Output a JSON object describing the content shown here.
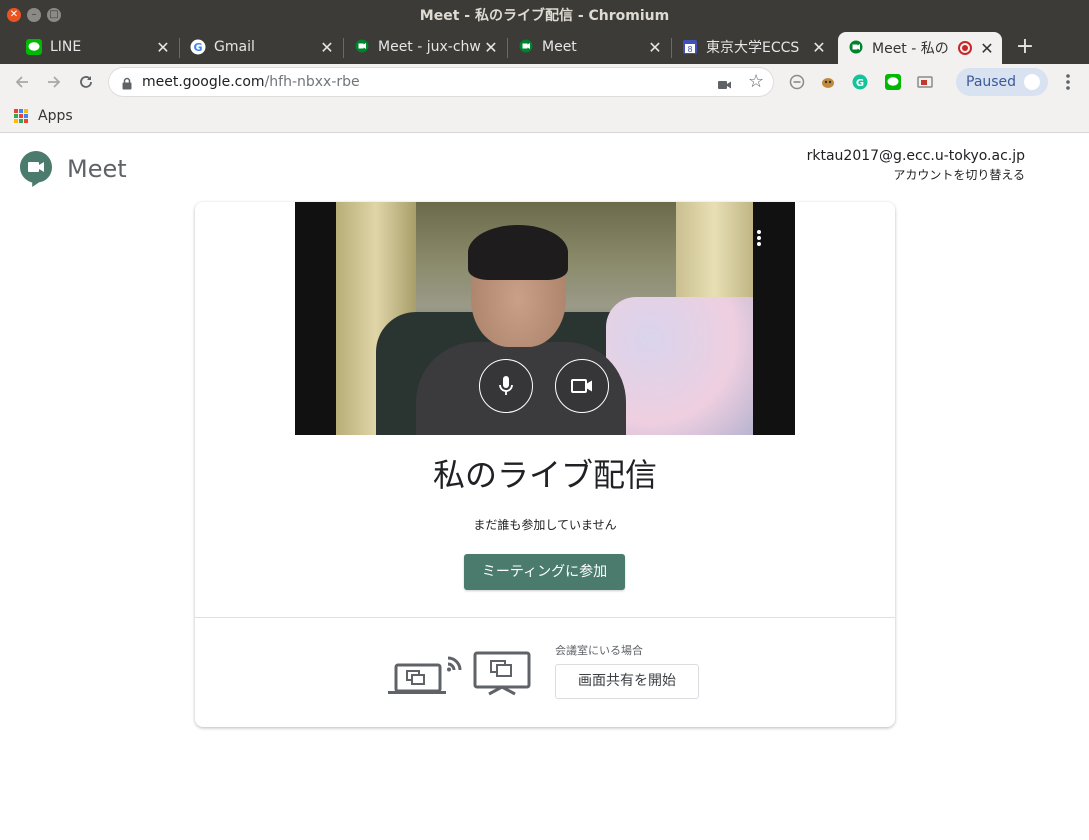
{
  "window": {
    "title": "Meet - 私のライブ配信 - Chromium"
  },
  "tabs": [
    {
      "label": "LINE"
    },
    {
      "label": "Gmail"
    },
    {
      "label": "Meet - jux-chw"
    },
    {
      "label": "Meet"
    },
    {
      "label": "東京大学ECCS"
    },
    {
      "label": "Meet - 私の"
    }
  ],
  "calendar_favicon_day": "8",
  "address": {
    "host": "meet.google.com",
    "path": "/hfh-nbxx-rbe"
  },
  "profile": {
    "label": "Paused"
  },
  "bookmarks": {
    "apps_label": "Apps"
  },
  "brand": {
    "name": "Meet"
  },
  "account": {
    "email": "rktau2017@g.ecc.u-tokyo.ac.jp",
    "switch_label": "アカウントを切り替える"
  },
  "meeting": {
    "title": "私のライブ配信",
    "status": "まだ誰も参加していません",
    "join_label": "ミーティングに参加",
    "room_label": "会議室にいる場合",
    "share_label": "画面共有を開始"
  },
  "colors": {
    "accent": "#4b7b6d",
    "titlebar": "#3c3b37",
    "toolbar": "#f2f1f0"
  }
}
